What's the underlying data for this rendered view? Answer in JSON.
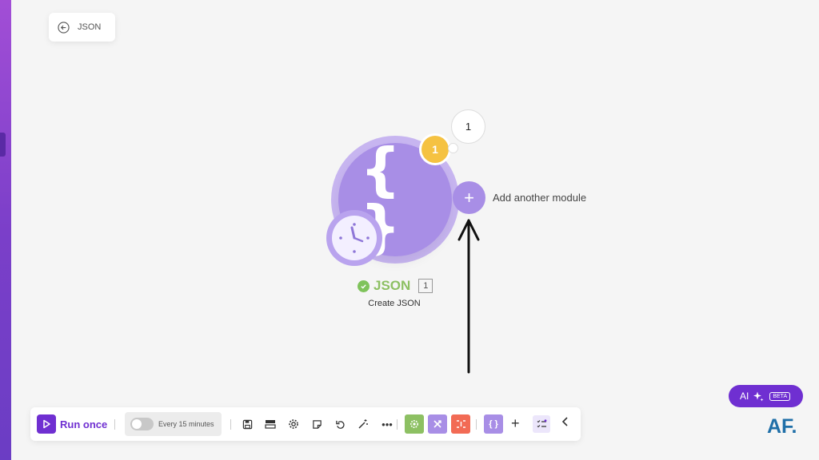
{
  "back_card": {
    "label": "JSON"
  },
  "module": {
    "name": "JSON",
    "subtitle": "Create JSON",
    "index": "1",
    "operations_count": "1",
    "bundle_count": "1",
    "color": "#a88ee6"
  },
  "add_module": {
    "label": "Add another module"
  },
  "toolbar": {
    "run_label": "Run once",
    "schedule_label": "Every 15 minutes",
    "schedule_enabled": false
  },
  "ai": {
    "label": "AI",
    "badge": "BETA"
  },
  "brand": {
    "logo_text": "AF."
  },
  "colors": {
    "accent": "#6f2fd1",
    "success": "#7fc35b",
    "bubble": "#f5c242",
    "tile_green": "#8dc063",
    "tile_purple": "#a88ee6",
    "tile_red": "#f26b55"
  }
}
